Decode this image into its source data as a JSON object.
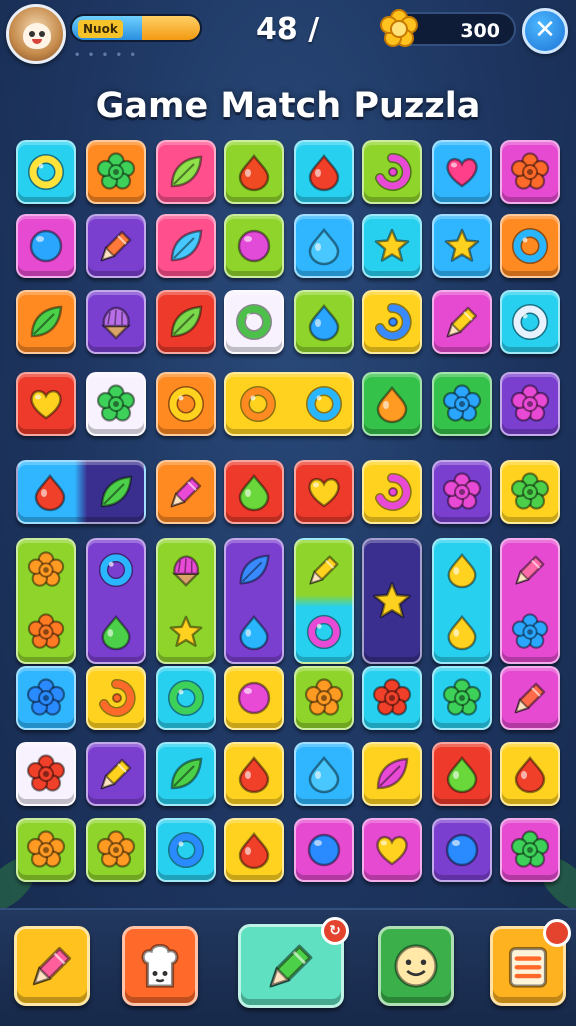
{
  "title": "Game Match Puzzla",
  "hud": {
    "player_label": "Nuok",
    "xp_progress": 0.55,
    "moves_text": "48 /",
    "coins": "300",
    "close_symbol": "✕"
  },
  "colors": {
    "blue": "#2fb6ff",
    "orange": "#ff8a22",
    "pink": "#ff4f8c",
    "lime": "#8fd42a",
    "magenta": "#e54ad0",
    "purple": "#7b3fd0",
    "yellow": "#ffd21f",
    "red": "#ee3a2a",
    "green": "#35c24a",
    "cyan": "#28d0f0",
    "white": "#f8f2ff",
    "navy": "#3a2f8e"
  },
  "board": {
    "rows": [
      [
        {
          "bg": "cyan",
          "icon": "ring-icon",
          "ic": "#ffe23a"
        },
        {
          "bg": "orange",
          "icon": "flower-icon",
          "ic": "#3ed15a"
        },
        {
          "bg": "pink",
          "icon": "leaf-icon",
          "ic": "#8fe04a"
        },
        {
          "bg": "lime",
          "icon": "drop-icon",
          "ic": "#f04a22"
        },
        {
          "bg": "cyan",
          "icon": "drop-icon",
          "ic": "#f0402a"
        },
        {
          "bg": "lime",
          "icon": "swirl-icon",
          "ic": "#e84ad6"
        },
        {
          "bg": "blue",
          "icon": "heart-icon",
          "ic": "#ff3f8a"
        },
        {
          "bg": "magenta",
          "icon": "flower-icon",
          "ic": "#ff6a2a"
        }
      ],
      [
        {
          "bg": "magenta",
          "icon": "circle-icon",
          "ic": "#2aa6ff"
        },
        {
          "bg": "purple",
          "icon": "pencil-icon",
          "ic": "#ff7a3a"
        },
        {
          "bg": "pink",
          "icon": "leaf-icon",
          "ic": "#47c8ff"
        },
        {
          "bg": "lime",
          "icon": "circle-icon",
          "ic": "#e24ad8"
        },
        {
          "bg": "blue",
          "icon": "drop-icon",
          "ic": "#48c8ff"
        },
        {
          "bg": "cyan",
          "icon": "star-icon",
          "ic": "#ffd21f"
        },
        {
          "bg": "blue",
          "icon": "star-icon",
          "ic": "#ffd21f"
        },
        {
          "bg": "orange",
          "icon": "ring-icon",
          "ic": "#2ab6ff"
        }
      ],
      [
        {
          "bg": "orange",
          "icon": "leaf-icon",
          "ic": "#4cd04a"
        },
        {
          "bg": "purple",
          "icon": "cone-icon",
          "ic": "#b86ee8"
        },
        {
          "bg": "red",
          "icon": "leaf-icon",
          "ic": "#7ad84a"
        },
        {
          "bg": "white",
          "icon": "ring-icon",
          "ic": "#4cc04a"
        },
        {
          "bg": "lime",
          "icon": "drop-icon",
          "ic": "#2aa6ff"
        },
        {
          "bg": "yellow",
          "icon": "swirl-icon",
          "ic": "#3a8aff"
        },
        {
          "bg": "magenta",
          "icon": "pencil-icon",
          "ic": "#ffd21f"
        },
        {
          "bg": "cyan",
          "icon": "ring-icon",
          "ic": "#e8f2ff"
        }
      ],
      [
        {
          "bg": "red",
          "icon": "heart-icon",
          "ic": "#ffd21f"
        },
        {
          "bg": "white",
          "icon": "flower-icon",
          "ic": "#3ed15a"
        },
        {
          "bg": "orange",
          "icon": "ring-icon",
          "ic": "#ffd21f"
        },
        {
          "bg": "yellow",
          "icon": "ring-icon",
          "ic": "#ff8a22",
          "wide": true,
          "ic2": "#2ab6ff"
        },
        {
          "bg": "green",
          "icon": "drop-icon",
          "ic": "#ff9a22"
        },
        {
          "bg": "green",
          "icon": "flower-icon",
          "ic": "#2aa6ff"
        },
        {
          "bg": "purple",
          "icon": "flower-icon",
          "ic": "#e84ad6"
        }
      ],
      [
        {
          "bg": "blue",
          "icon": "drop-icon",
          "ic": "#f0402a",
          "wide": true,
          "ic2": "#4cd04a",
          "bg2": "navy",
          "icon2": "leaf-icon"
        },
        {
          "bg": "orange",
          "icon": "pencil-icon",
          "ic": "#e84ad6"
        },
        {
          "bg": "red",
          "icon": "drop-icon",
          "ic": "#6ad83a"
        },
        {
          "bg": "red",
          "icon": "heart-icon",
          "ic": "#ffd21f"
        },
        {
          "bg": "yellow",
          "icon": "swirl-icon",
          "ic": "#e84ad6"
        },
        {
          "bg": "purple",
          "icon": "flower-icon",
          "ic": "#e84ad6"
        },
        {
          "bg": "yellow",
          "icon": "flower-icon",
          "ic": "#4cd04a"
        }
      ],
      [
        {
          "bg": "lime",
          "icon": "flower-icon",
          "ic": "#ff9a22",
          "tall": true,
          "icon2": "flower-icon",
          "ic2": "#ff7a22"
        },
        {
          "bg": "purple",
          "icon": "ring-icon",
          "ic": "#2ab6ff",
          "tall": true,
          "icon2": "drop-icon",
          "ic2": "#4cd04a"
        },
        {
          "bg": "lime",
          "icon": "cone-icon",
          "ic": "#e84ad6",
          "tall": true,
          "icon2": "star-icon",
          "ic2": "#ffd21f"
        },
        {
          "bg": "purple",
          "icon": "leaf-icon",
          "ic": "#3a8aff",
          "tall": true,
          "icon2": "drop-icon",
          "ic2": "#2ab6ff"
        },
        {
          "bg": "lime",
          "icon": "pencil-icon",
          "ic": "#ffd21f",
          "tall": true,
          "icon2": "ring-icon",
          "ic2": "#e84ad6",
          "bg2": "cyan"
        },
        {
          "bg": "navy",
          "icon": "star-icon",
          "ic": "#ffd21f",
          "tall": true
        },
        {
          "bg": "cyan",
          "icon": "drop-icon",
          "ic": "#ffd21f",
          "tall": true,
          "icon2": "drop-icon",
          "ic2": "#ffd21f"
        },
        {
          "bg": "magenta",
          "icon": "pencil-icon",
          "ic": "#ff6aa8",
          "tall": true,
          "icon2": "flower-icon",
          "ic2": "#2aa6ff"
        }
      ],
      [
        {
          "bg": "blue",
          "icon": "flower-icon",
          "ic": "#2a8aff"
        },
        {
          "bg": "yellow",
          "icon": "swirl-icon",
          "ic": "#ff6a2a"
        },
        {
          "bg": "cyan",
          "icon": "ring-icon",
          "ic": "#3ed15a"
        },
        {
          "bg": "yellow",
          "icon": "circle-icon",
          "ic": "#e84ad6"
        },
        {
          "bg": "lime",
          "icon": "flower-icon",
          "ic": "#ff9a22"
        },
        {
          "bg": "cyan",
          "icon": "flower-icon",
          "ic": "#f0402a"
        },
        {
          "bg": "cyan",
          "icon": "flower-icon",
          "ic": "#3ed15a"
        },
        {
          "bg": "magenta",
          "icon": "pencil-icon",
          "ic": "#ff6a4a"
        }
      ],
      [
        {
          "bg": "white",
          "icon": "flower-icon",
          "ic": "#f0402a"
        },
        {
          "bg": "purple",
          "icon": "pencil-icon",
          "ic": "#ffd21f"
        },
        {
          "bg": "cyan",
          "icon": "leaf-icon",
          "ic": "#4cd04a"
        },
        {
          "bg": "yellow",
          "icon": "drop-icon",
          "ic": "#f0402a"
        },
        {
          "bg": "blue",
          "icon": "drop-icon",
          "ic": "#48c8ff"
        },
        {
          "bg": "yellow",
          "icon": "leaf-icon",
          "ic": "#e84ad6"
        },
        {
          "bg": "red",
          "icon": "drop-icon",
          "ic": "#6ad83a"
        },
        {
          "bg": "yellow",
          "icon": "drop-icon",
          "ic": "#f0402a"
        }
      ],
      [
        {
          "bg": "lime",
          "icon": "flower-icon",
          "ic": "#ff9a22"
        },
        {
          "bg": "lime",
          "icon": "flower-icon",
          "ic": "#ff9a22"
        },
        {
          "bg": "cyan",
          "icon": "ring-icon",
          "ic": "#2a8aff"
        },
        {
          "bg": "yellow",
          "icon": "drop-icon",
          "ic": "#f0402a"
        },
        {
          "bg": "magenta",
          "icon": "circle-icon",
          "ic": "#2a8aff"
        },
        {
          "bg": "magenta",
          "icon": "heart-icon",
          "ic": "#ffd21f"
        },
        {
          "bg": "purple",
          "icon": "circle-icon",
          "ic": "#2a8aff"
        },
        {
          "bg": "magenta",
          "icon": "flower-icon",
          "ic": "#3ed15a"
        }
      ]
    ]
  },
  "footer": [
    {
      "name": "pencil-tool-button",
      "bg": "#ffc21f",
      "icon": "pencil-icon",
      "ic": "#ff5f9a"
    },
    {
      "name": "chef-booster-button",
      "bg": "#ff6a2a",
      "icon": "chef-icon",
      "ic": "#ffffff"
    },
    {
      "name": "shovel-booster-button",
      "bg": "#5fe0c0",
      "icon": "pencil-icon",
      "ic": "#4cd04a",
      "big": true,
      "badge": "↻"
    },
    {
      "name": "hint-face-button",
      "bg": "#3bb04a",
      "icon": "face-icon",
      "ic": "#ffe8a8"
    },
    {
      "name": "menu-list-button",
      "bg": "#ffb21f",
      "icon": "list-icon",
      "ic": "#ff6a2a",
      "badge": ""
    }
  ]
}
